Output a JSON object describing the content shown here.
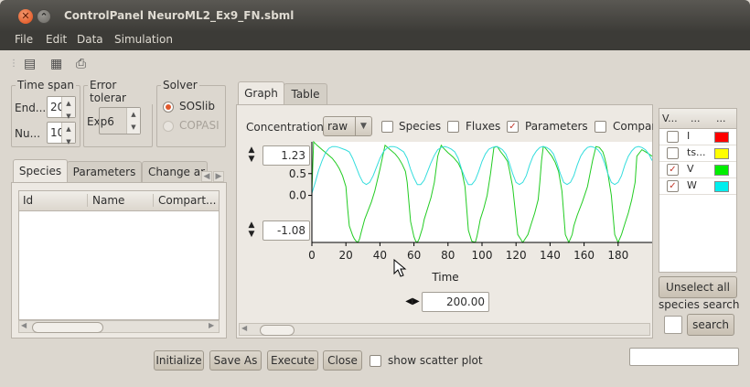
{
  "window": {
    "title": "ControlPanel NeuroML2_Ex9_FN.sbml"
  },
  "menubar": [
    "File",
    "Edit",
    "Data",
    "Simulation"
  ],
  "toolbar": {
    "icons": [
      "open-icon",
      "save-icon",
      "print-icon"
    ]
  },
  "time_span": {
    "title": "Time span",
    "end_label": "End...",
    "end_value": "20",
    "num_label": "Nu...",
    "num_value": "10"
  },
  "error_tol": {
    "title": "Error tolerar",
    "value": "Exp6"
  },
  "solver": {
    "title": "Solver",
    "options": [
      "SOSlib",
      "COPASI"
    ],
    "selected": "SOSlib"
  },
  "left_tabs": [
    "Species",
    "Parameters",
    "Change ar"
  ],
  "species_table": {
    "columns": [
      "Id",
      "Name",
      "Compart..."
    ],
    "rows": []
  },
  "right_tabs": [
    "Graph",
    "Table"
  ],
  "graph_controls": {
    "concentration_label": "Concentration",
    "concentration_mode": "raw",
    "filters": [
      {
        "label": "Species",
        "checked": false
      },
      {
        "label": "Fluxes",
        "checked": false
      },
      {
        "label": "Parameters",
        "checked": true
      },
      {
        "label": "Compar",
        "checked": false
      }
    ],
    "y_max": "1.23",
    "y_min": "-1.08",
    "x_max": "200.00"
  },
  "legend_table": {
    "columns": [
      "V...",
      "...",
      "..."
    ],
    "rows": [
      {
        "name": "I",
        "checked": false,
        "color": "#ff0000"
      },
      {
        "name": "ts...",
        "checked": false,
        "color": "#ffff00"
      },
      {
        "name": "V",
        "checked": true,
        "color": "#00ee00"
      },
      {
        "name": "W",
        "checked": true,
        "color": "#00eeee"
      }
    ]
  },
  "right_panel": {
    "unselect_all": "Unselect all",
    "species_search_label": "species search",
    "search_button": "search"
  },
  "bottom": {
    "initialize": "Initialize",
    "save_as": "Save As",
    "execute": "Execute",
    "close": "Close",
    "show_scatter": "show scatter plot"
  },
  "chart_data": {
    "type": "line",
    "xlabel": "Time",
    "ylabel": "",
    "xlim": [
      0,
      200
    ],
    "ylim": [
      -1.08,
      1.23
    ],
    "x_ticks": [
      0,
      20,
      40,
      60,
      80,
      100,
      120,
      140,
      160,
      180
    ],
    "y_ticks": [
      0.5,
      0.0
    ],
    "y_tick_labels": [
      "0.5",
      "0.0"
    ],
    "series": [
      {
        "name": "V",
        "color": "#22cc22",
        "x": [
          0,
          1,
          3,
          6,
          9,
          12,
          14,
          16,
          18,
          20,
          21,
          22,
          24,
          25,
          26,
          27,
          28,
          29,
          30,
          31,
          33,
          35,
          37,
          40,
          43,
          46,
          49,
          51,
          53,
          55,
          56,
          58,
          60,
          61,
          62,
          63,
          65,
          66,
          68,
          70,
          72,
          74,
          76,
          77,
          80,
          83,
          86,
          88,
          90,
          92,
          94,
          96,
          97,
          98,
          99,
          101,
          103,
          105,
          107,
          109,
          111,
          113,
          115,
          116,
          118,
          121,
          124,
          127,
          129,
          131,
          133,
          134,
          135,
          136,
          137,
          139,
          141,
          143,
          145,
          147,
          149,
          151,
          153,
          154,
          156,
          159,
          162,
          165,
          167,
          169,
          171,
          172,
          173,
          174,
          176,
          178,
          180,
          182,
          184,
          186,
          188,
          190,
          191,
          194,
          197,
          200
        ],
        "y": [
          0.1,
          1.23,
          1.15,
          1.05,
          0.95,
          0.85,
          0.75,
          0.62,
          0.45,
          0.2,
          -0.3,
          -0.7,
          -0.92,
          -1.0,
          -1.05,
          -1.08,
          -1.0,
          -0.85,
          -0.7,
          -0.55,
          -0.35,
          -0.15,
          0.1,
          0.6,
          1.15,
          1.05,
          0.95,
          0.85,
          0.72,
          0.55,
          0.3,
          -0.6,
          -0.95,
          -1.05,
          -1.08,
          -1.0,
          -0.75,
          -0.55,
          -0.3,
          -0.05,
          0.3,
          0.9,
          1.15,
          1.1,
          0.98,
          0.88,
          0.74,
          0.58,
          0.2,
          -0.8,
          -1.05,
          -1.08,
          -0.95,
          -0.75,
          -0.55,
          -0.3,
          0.0,
          0.5,
          1.1,
          1.12,
          1.0,
          0.9,
          0.78,
          0.6,
          0.2,
          -0.9,
          -1.08,
          -0.9,
          -0.65,
          -0.4,
          -0.1,
          0.3,
          0.8,
          1.12,
          1.1,
          1.0,
          0.9,
          0.76,
          0.55,
          0.1,
          -0.9,
          -1.08,
          -0.9,
          -0.7,
          -0.45,
          -0.15,
          0.2,
          0.8,
          1.12,
          1.1,
          1.0,
          0.88,
          0.72,
          0.5,
          0.0,
          -0.9,
          -1.08,
          -0.9,
          -0.65,
          -0.4,
          -0.1,
          0.3,
          0.9,
          1.05,
          0.98,
          0.9
        ]
      },
      {
        "name": "W",
        "color": "#33dddd",
        "x": [
          0,
          2,
          4,
          6,
          8,
          10,
          12,
          14,
          16,
          18,
          20,
          22,
          24,
          26,
          28,
          30,
          32,
          34,
          36,
          38,
          40,
          42,
          44,
          46,
          48,
          50,
          52,
          54,
          56,
          58,
          60,
          62,
          64,
          66,
          68,
          70,
          72,
          74,
          76,
          78,
          80,
          82,
          84,
          86,
          88,
          90,
          92,
          94,
          96,
          98,
          100,
          102,
          104,
          106,
          108,
          110,
          112,
          114,
          116,
          118,
          120,
          122,
          124,
          126,
          128,
          130,
          132,
          134,
          136,
          138,
          140,
          142,
          144,
          146,
          148,
          150,
          152,
          154,
          156,
          158,
          160,
          162,
          164,
          166,
          168,
          170,
          172,
          174,
          176,
          178,
          180,
          182,
          184,
          186,
          188,
          190,
          192,
          194,
          196,
          198,
          200
        ],
        "y": [
          0.05,
          0.3,
          0.58,
          0.8,
          0.98,
          1.08,
          1.12,
          1.12,
          1.1,
          1.07,
          1.04,
          1.0,
          0.85,
          0.65,
          0.45,
          0.3,
          0.25,
          0.3,
          0.45,
          0.65,
          0.85,
          1.0,
          1.08,
          1.12,
          1.12,
          1.1,
          1.05,
          1.0,
          0.85,
          0.6,
          0.4,
          0.25,
          0.25,
          0.35,
          0.55,
          0.75,
          0.92,
          1.05,
          1.1,
          1.12,
          1.1,
          1.06,
          1.0,
          0.85,
          0.6,
          0.4,
          0.25,
          0.25,
          0.35,
          0.55,
          0.78,
          0.95,
          1.06,
          1.1,
          1.12,
          1.1,
          1.05,
          0.95,
          0.75,
          0.5,
          0.3,
          0.25,
          0.3,
          0.45,
          0.7,
          0.9,
          1.02,
          1.1,
          1.12,
          1.1,
          1.05,
          0.95,
          0.75,
          0.5,
          0.3,
          0.25,
          0.3,
          0.45,
          0.7,
          0.9,
          1.02,
          1.1,
          1.12,
          1.1,
          1.05,
          0.95,
          0.75,
          0.5,
          0.3,
          0.25,
          0.3,
          0.45,
          0.7,
          0.9,
          1.02,
          1.1,
          1.12,
          1.1,
          1.05,
          0.95,
          0.8
        ]
      }
    ]
  }
}
